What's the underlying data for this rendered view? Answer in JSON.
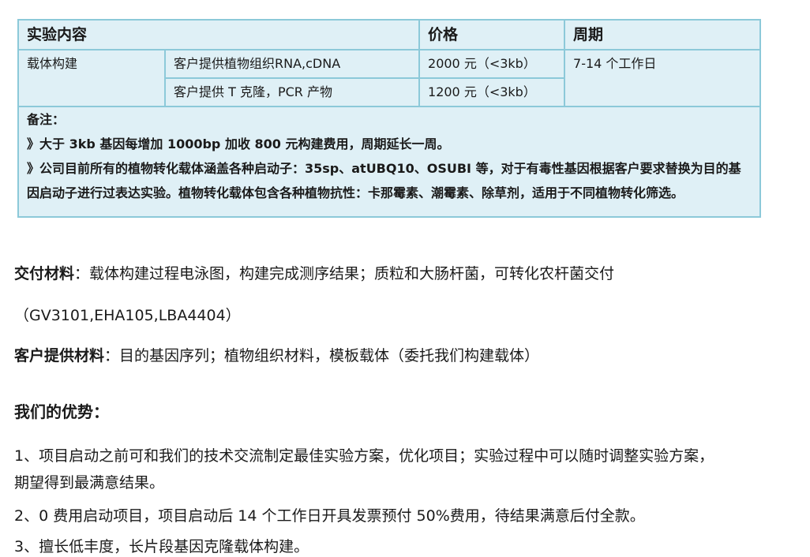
{
  "table": {
    "headers": [
      "实验内容",
      "价格",
      "周期"
    ],
    "rows": [
      {
        "category": "载体构建",
        "item": "客户提供植物组织RNA,cDNA",
        "price": "2000 元（<3kb）",
        "period": "7-14 个工作日"
      },
      {
        "item": "客户提供 T 克隆，PCR 产物",
        "price": "1200 元（<3kb）"
      }
    ],
    "notes": {
      "title": "备注：",
      "line1": "》大于 3kb 基因每增加 1000bp 加收 800 元构建费用，周期延长一周。",
      "line2a": "》公司目前所有的植物转化载体涵盖各种启动子：35sp、atUBQ10、OSUBI 等，对于有毒性基因根据客户要求替换为目的基",
      "line2b": "因启动子进行过表达实验。植物转化载体包含各种植物抗性：卡那霉素、潮霉素、除草剂，适用于不同植物转化筛选。"
    }
  },
  "deliverables": {
    "label": "交付材料",
    "text": "：载体构建过程电泳图，构建完成测序结果；质粒和大肠杆菌，可转化农杆菌交付",
    "text2": "（GV3101,EHA105,LBA4404）"
  },
  "customer_materials": {
    "label": "客户提供材料",
    "text": "：目的基因序列；植物组织材料，模板载体（委托我们构建载体）"
  },
  "advantages": {
    "title": "我们的优势：",
    "item1a": "1、项目启动之前可和我们的技术交流制定最佳实验方案，优化项目；实验过程中可以随时调整实验方案，",
    "item1b": "期望得到最满意结果。",
    "item2": "2、0 费用启动项目，项目启动后 14 个工作日开具发票预付 50%费用，待结果满意后付全款。",
    "item3": "3、擅长低丰度，长片段基因克隆载体构建。"
  }
}
